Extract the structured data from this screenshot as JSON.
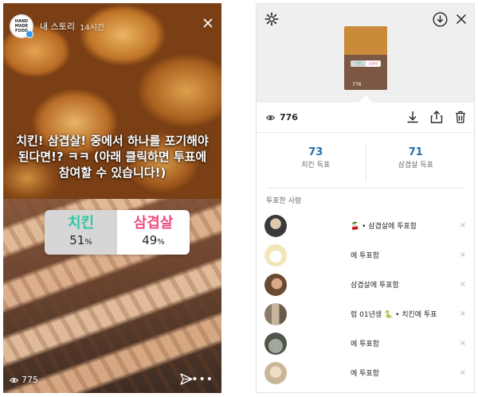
{
  "story": {
    "username": "내 스토리",
    "time": "14시간",
    "brand_lines": [
      "HAND",
      "MADE",
      "FOOD"
    ],
    "caption": "치킨! 삼겹살! 중에서 하나를 포기해야 된다면!? ㅋㅋ (아래 클릭하면 투표에 참여할 수 있습니다!)",
    "poll": {
      "options": [
        {
          "label": "치킨",
          "percent": "51",
          "unit": "%"
        },
        {
          "label": "삼겹살",
          "percent": "49",
          "unit": "%"
        }
      ]
    },
    "view_count": "775"
  },
  "panel": {
    "thumbnail": {
      "poll_left": "치킨",
      "poll_right": "삼겹살",
      "view_count": "776"
    },
    "view_count": "776",
    "votes": [
      {
        "count": "73",
        "label": "치킨 득표"
      },
      {
        "count": "71",
        "label": "삼겹살 득표"
      }
    ],
    "voters_title": "투표한 사람",
    "voters": [
      {
        "prefix_emoji": "🍒",
        "text": "• 삼겹살에 투표함",
        "avatar_color": "#555555"
      },
      {
        "prefix_emoji": "",
        "text": "에 투표함",
        "avatar_color": "#f2e6b8"
      },
      {
        "prefix_emoji": "",
        "text": "삼겹살에 투표함",
        "avatar_color": "#6b4a32"
      },
      {
        "prefix_emoji": "",
        "text": "럼 01년생 🐍 • 치킨에 투표",
        "avatar_color": "#4f4f4f"
      },
      {
        "prefix_emoji": "",
        "text": "에 투표함",
        "avatar_color": "#8a8f86"
      },
      {
        "prefix_emoji": "",
        "text": "에 투표함",
        "avatar_color": "#c9b69a"
      }
    ],
    "remove_symbol": "×"
  },
  "colors": {
    "chicken_accent": "#2fc7a6",
    "pork_accent": "#ee4d7d",
    "vote_count": "#1f6fa8"
  }
}
